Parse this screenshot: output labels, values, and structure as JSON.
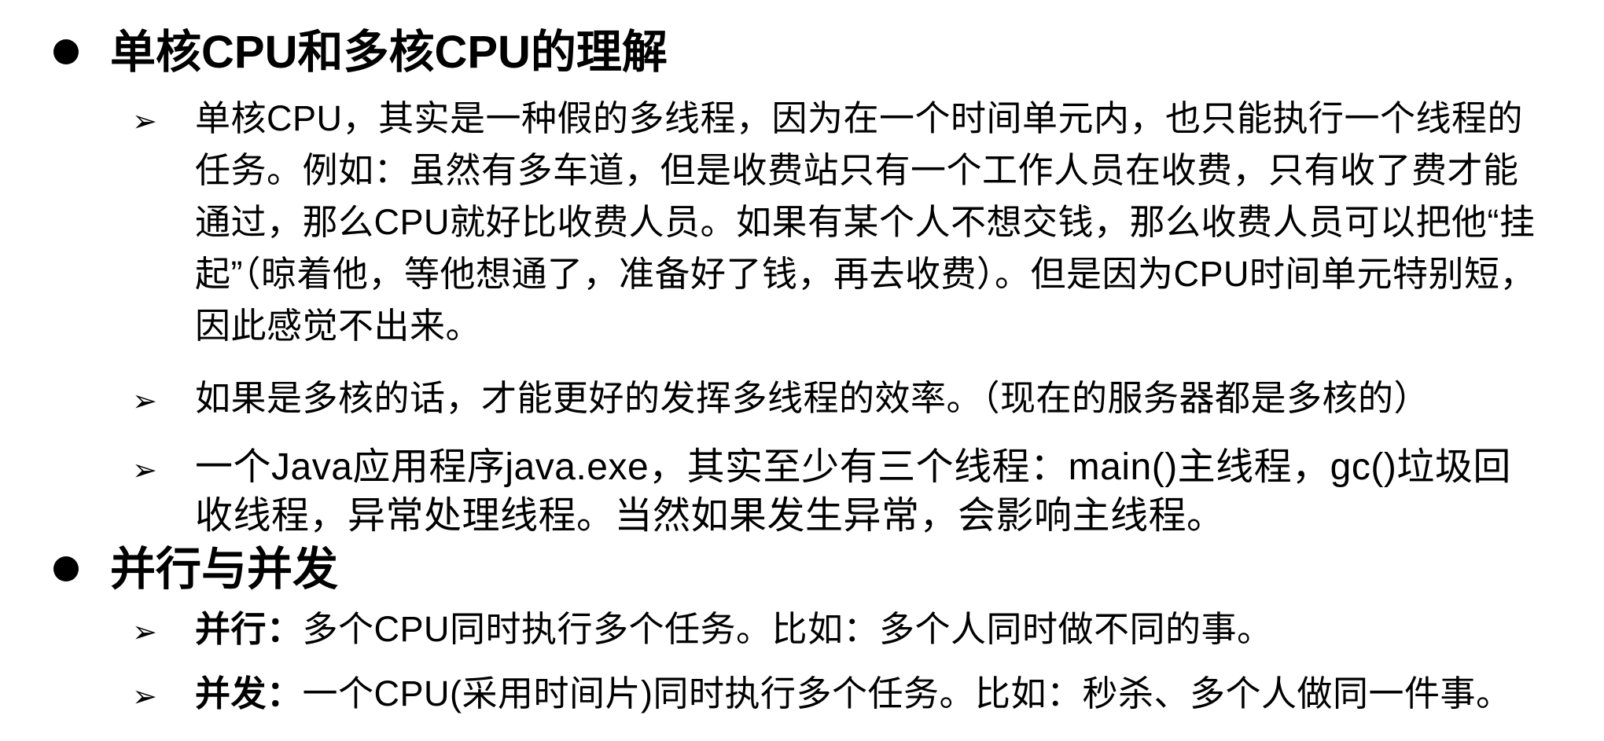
{
  "sections": [
    {
      "heading": "单核CPU和多核CPU的理解",
      "items": [
        {
          "text": "单核CPU，其实是一种假的多线程，因为在一个时间单元内，也只能执行一个线程的任务。例如：虽然有多车道，但是收费站只有一个工作人员在收费，只有收了费才能通过，那么CPU就好比收费人员。如果有某个人不想交钱，那么收费人员可以把他“挂起”（晾着他，等他想通了，准备好了钱，再去收费）。但是因为CPU时间单元特别短，因此感觉不出来。"
        },
        {
          "text": "如果是多核的话，才能更好的发挥多线程的效率。（现在的服务器都是多核的）"
        },
        {
          "text": "一个Java应用程序java.exe，其实至少有三个线程：main()主线程，gc()垃圾回收线程，异常处理线程。当然如果发生异常，会影响主线程。"
        }
      ]
    },
    {
      "heading": "并行与并发",
      "items": [
        {
          "lead": "并行：",
          "text": "多个CPU同时执行多个任务。比如：多个人同时做不同的事。"
        },
        {
          "lead": "并发：",
          "text": "一个CPU(采用时间片)同时执行多个任务。比如：秒杀、多个人做同一件事。"
        }
      ]
    }
  ],
  "bullet_glyph": "➢"
}
